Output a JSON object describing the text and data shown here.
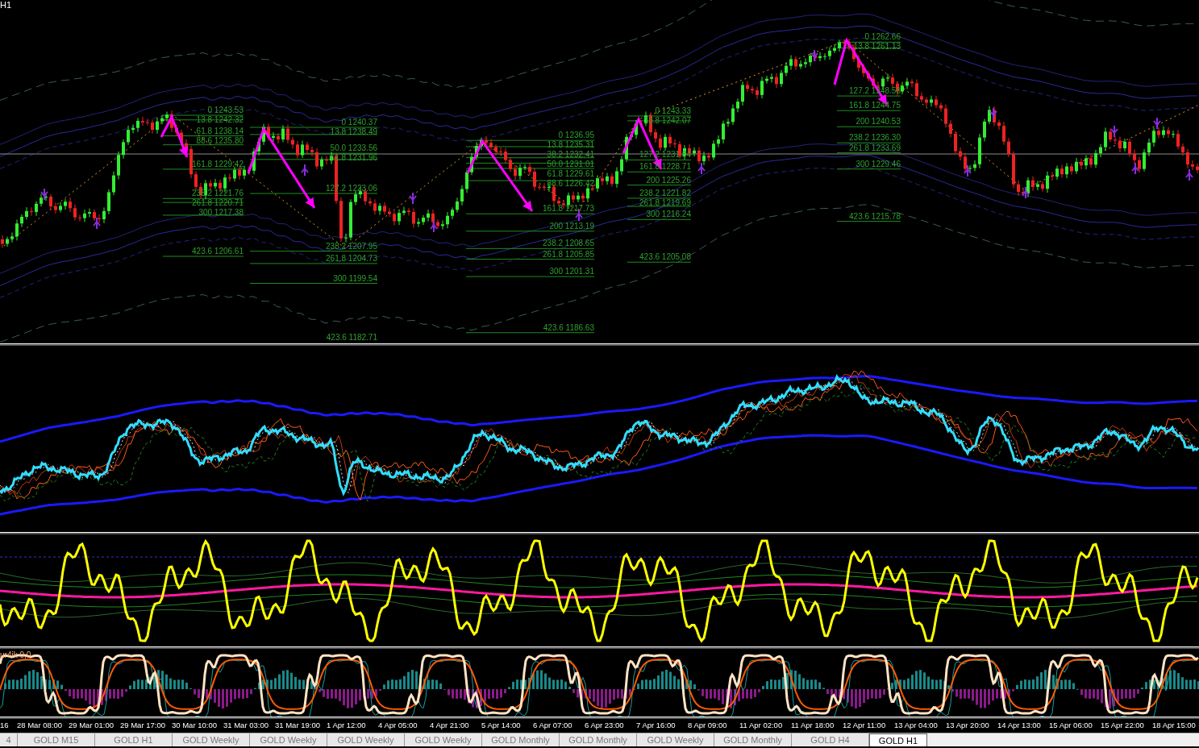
{
  "chart": {
    "timeframe_label": "H1",
    "fibonacci": [
      {
        "levels": [
          "0 1243.53",
          "13.8 1242.32",
          "61.8 1238.14",
          "88.6 1235.80",
          "161.8 1229.42",
          "238.2 1221.76",
          "261.8 1220.71",
          "300 1217.38",
          "423.6 1206.61"
        ]
      },
      {
        "levels": [
          "0 1240.37",
          "13.8 1238.49",
          "50.0 1233.56",
          "61.8 1231.96",
          "127.2 1223.06",
          "238.2 1207.95",
          "261.8 1204.73",
          "300 1199.54",
          "423.6 1182.71"
        ]
      },
      {
        "levels": [
          "0 1236.95",
          "13.8 1235.31",
          "38.2 1232.41",
          "50.0 1231.01",
          "61.8 1229.61",
          "88.6 1226.42",
          "161.8 1217.73",
          "200 1213.19",
          "238.2 1208.65",
          "261.8 1205.85",
          "300 1201.31",
          "423.6 1186.63"
        ]
      },
      {
        "levels": [
          "0 1243.33",
          "13.8 1242.07",
          "127.2 1231.84",
          "161.8 1228.71",
          "200 1225.26",
          "238.2 1221.82",
          "261.8 1219.69",
          "300 1216.24",
          "423.6 1205.08"
        ]
      },
      {
        "levels": [
          "0 1262.66",
          "13.8 1261.13",
          "127.2 1248.58",
          "161.8 1244.75",
          "200 1240.53",
          "238.2 1236.30",
          "261.8 1233.69",
          "300 1229.46",
          "423.6 1215.78"
        ]
      }
    ]
  },
  "oscillator_label": "ur4ik 0,0",
  "time_axis": [
    "16",
    "28 Mar 08:00",
    "29 Mar 01:00",
    "29 Mar 17:00",
    "30 Mar 10:00",
    "31 Mar 03:00",
    "31 Mar 19:00",
    "1 Apr 12:00",
    "4 Apr 05:00",
    "4 Apr 21:00",
    "5 Apr 14:00",
    "6 Apr 07:00",
    "6 Apr 23:00",
    "7 Apr 16:00",
    "8 Apr 09:00",
    "11 Apr 02:00",
    "11 Apr 18:00",
    "12 Apr 11:00",
    "13 Apr 04:00",
    "13 Apr 20:00",
    "14 Apr 13:00",
    "15 Apr 06:00",
    "15 Apr 22:00",
    "18 Apr 15:00"
  ],
  "tabs": [
    {
      "label": "4",
      "selected": false
    },
    {
      "label": "GOLD M15",
      "selected": false
    },
    {
      "label": "GOLD H1",
      "selected": false
    },
    {
      "label": "GOLD Weekly",
      "selected": false
    },
    {
      "label": "GOLD Weekly",
      "selected": false
    },
    {
      "label": "GOLD Weekly",
      "selected": false
    },
    {
      "label": "GOLD Weekly",
      "selected": false
    },
    {
      "label": "GOLD Monthly",
      "selected": false
    },
    {
      "label": "GOLD Monthly",
      "selected": false
    },
    {
      "label": "GOLD Weekly",
      "selected": false
    },
    {
      "label": "GOLD Monthly",
      "selected": false
    },
    {
      "label": "GOLD H4",
      "selected": false
    },
    {
      "label": "GOLD H1",
      "selected": true
    }
  ]
}
